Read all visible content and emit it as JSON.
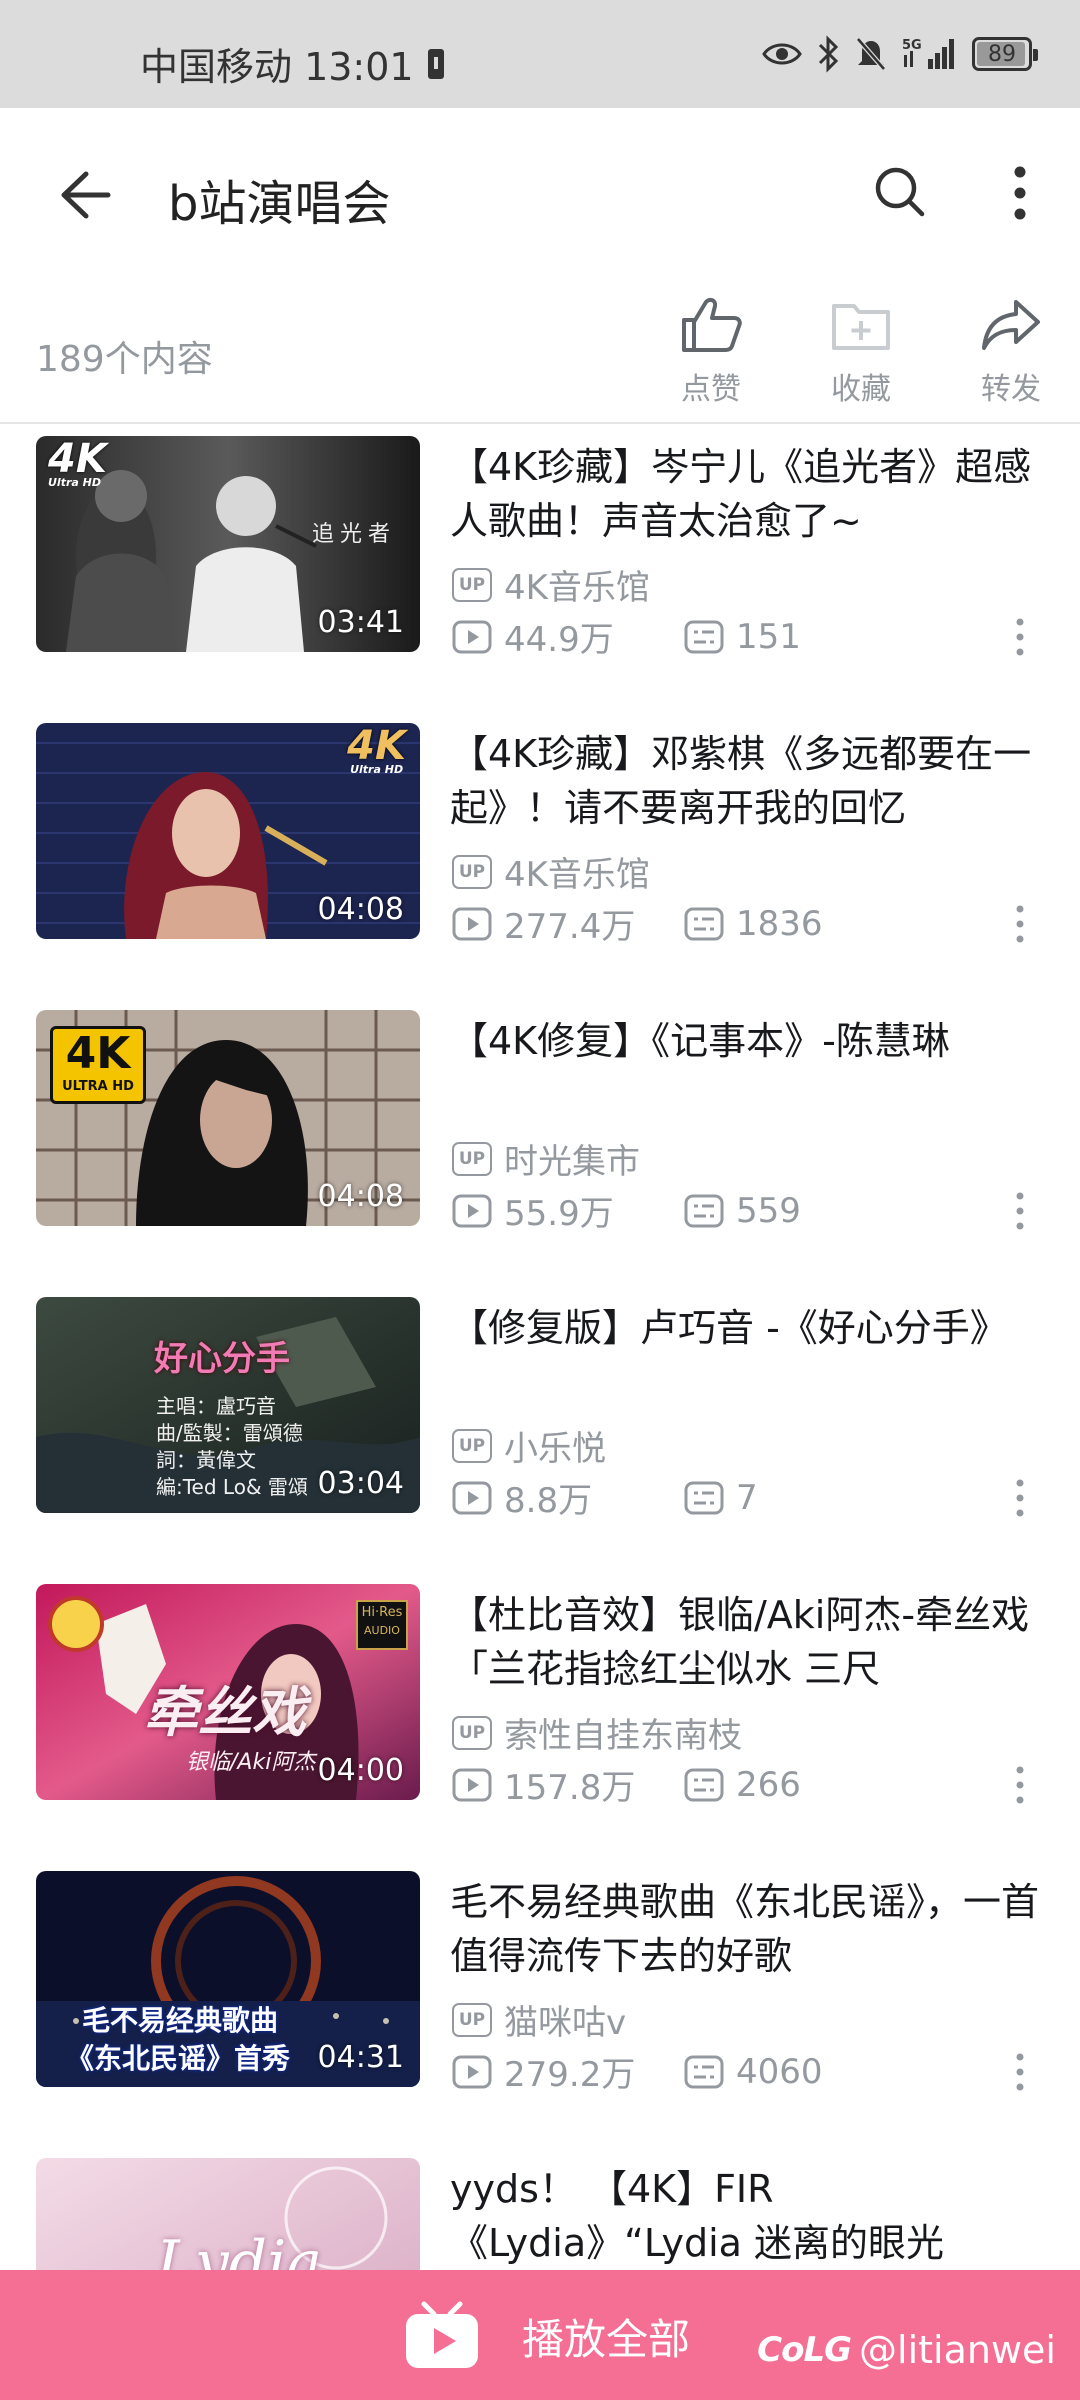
{
  "status_bar": {
    "carrier_time": "中国移动 13:01",
    "network": "5G",
    "battery": "89"
  },
  "nav": {
    "title": "b站演唱会"
  },
  "header": {
    "count": "189个内容",
    "actions": [
      {
        "label": "点赞"
      },
      {
        "label": "收藏"
      },
      {
        "label": "转发"
      }
    ]
  },
  "videos": [
    {
      "title": "【4K珍藏】岑宁儿《追光者》超感人歌曲！声音太治愈了~",
      "uploader": "4K音乐馆",
      "views": "44.9万",
      "comments": "151",
      "duration": "03:41",
      "thumb_text": "追光者"
    },
    {
      "title": "【4K珍藏】邓紫棋《多远都要在一起》！请不要离开我的回忆",
      "uploader": "4K音乐馆",
      "views": "277.4万",
      "comments": "1836",
      "duration": "04:08"
    },
    {
      "title": "【4K修复】《记事本》-陈慧琳",
      "uploader": "时光集市",
      "views": "55.9万",
      "comments": "559",
      "duration": "04:08"
    },
    {
      "title": "【修复版】卢巧音 -《好心分手》",
      "uploader": "小乐悦",
      "views": "8.8万",
      "comments": "7",
      "duration": "03:04",
      "thumb_title": "好心分手",
      "thumb_lines": [
        "主唱：盧巧音",
        "曲/監製：雷頌德",
        "詞：黃偉文",
        "編:Ted Lo& 雷頌"
      ]
    },
    {
      "title": "【杜比音效】银临/Aki阿杰-牵丝戏「兰花指捻红尘似水 三尺",
      "uploader": "索性自挂东南枝",
      "views": "157.8万",
      "comments": "266",
      "duration": "04:00",
      "thumb_title": "牵丝戏",
      "thumb_sub": "银临/Aki阿杰",
      "hires": [
        "Hi·Res",
        "AUDIO"
      ]
    },
    {
      "title": "毛不易经典歌曲《东北民谣》，一首值得流传下去的好歌",
      "uploader": "猫咪咕v",
      "views": "279.2万",
      "comments": "4060",
      "duration": "04:31",
      "thumb_lines": [
        "毛不易经典歌曲",
        "《东北民谣》首秀"
      ]
    },
    {
      "title": "yyds！ 【4K】FIR《Lydia》“Lydia 迷离的眼光",
      "uploader": "",
      "views": "",
      "comments": "",
      "duration": "",
      "thumb_title": "Lydia"
    }
  ],
  "badges": {
    "k4": "4K",
    "ultra_hd": "Ultra HD",
    "ultra_hd_caps": "ULTRA HD",
    "up": "UP"
  },
  "bottom": {
    "play_all": "播放全部",
    "watermark_logo": "CoLG",
    "watermark_user": "@litianwei"
  },
  "colors": {
    "accent_pink": "#f56e94",
    "gray_text": "#9499a0",
    "title_text": "#18191c"
  }
}
